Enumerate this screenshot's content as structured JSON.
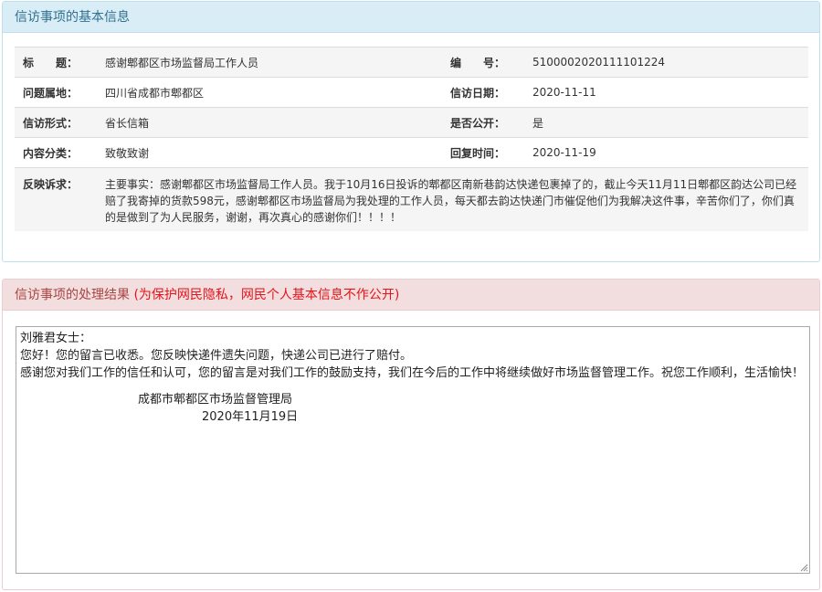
{
  "basic_panel": {
    "title": "信访事项的基本信息",
    "fields": {
      "title_label": "标　　题：",
      "title_value": "感谢郫都区市场监督局工作人员",
      "number_label": "编　　号：",
      "number_value": "5100002020111101224",
      "location_label": "问题属地：",
      "location_value": "四川省成都市郫都区",
      "date_label": "信访日期：",
      "date_value": "2020-11-11",
      "form_label": "信访形式：",
      "form_value": "省长信箱",
      "public_label": "是否公开：",
      "public_value": "是",
      "category_label": "内容分类：",
      "category_value": "致敬致谢",
      "reply_time_label": "回复时间：",
      "reply_time_value": "2020-11-19",
      "appeal_label": "反映诉求：",
      "appeal_value": "主要事实：感谢郫都区市场监督局工作人员。我于10月16日投诉的郫都区南新巷韵达快递包裹掉了的，截止今天11月11日郫都区韵达公司已经赔了我寄掉的货款598元，感谢郫都区市场监督局为我处理的工作人员，每天都去韵达快递门市催促他们为我解决这件事，辛苦你们了，你们真的是做到了为人民服务，谢谢，再次真心的感谢你们！！！！"
    }
  },
  "result_panel": {
    "title": "信访事项的处理结果",
    "note": "(为保护网民隐私，网民个人基本信息不作公开)",
    "reply": {
      "greeting": "刘雅君女士：",
      "line1": "您好！您的留言已收悉。您反映快递件遗失问题，快递公司已进行了赔付。",
      "line2": "感谢您对我们工作的信任和认可，您的留言是对我们工作的鼓励支持，我们在今后的工作中将继续做好市场监督管理工作。祝您工作顺利，生活愉快！",
      "signature": "成都市郫都区市场监督管理局",
      "date": "2020年11月19日"
    }
  }
}
